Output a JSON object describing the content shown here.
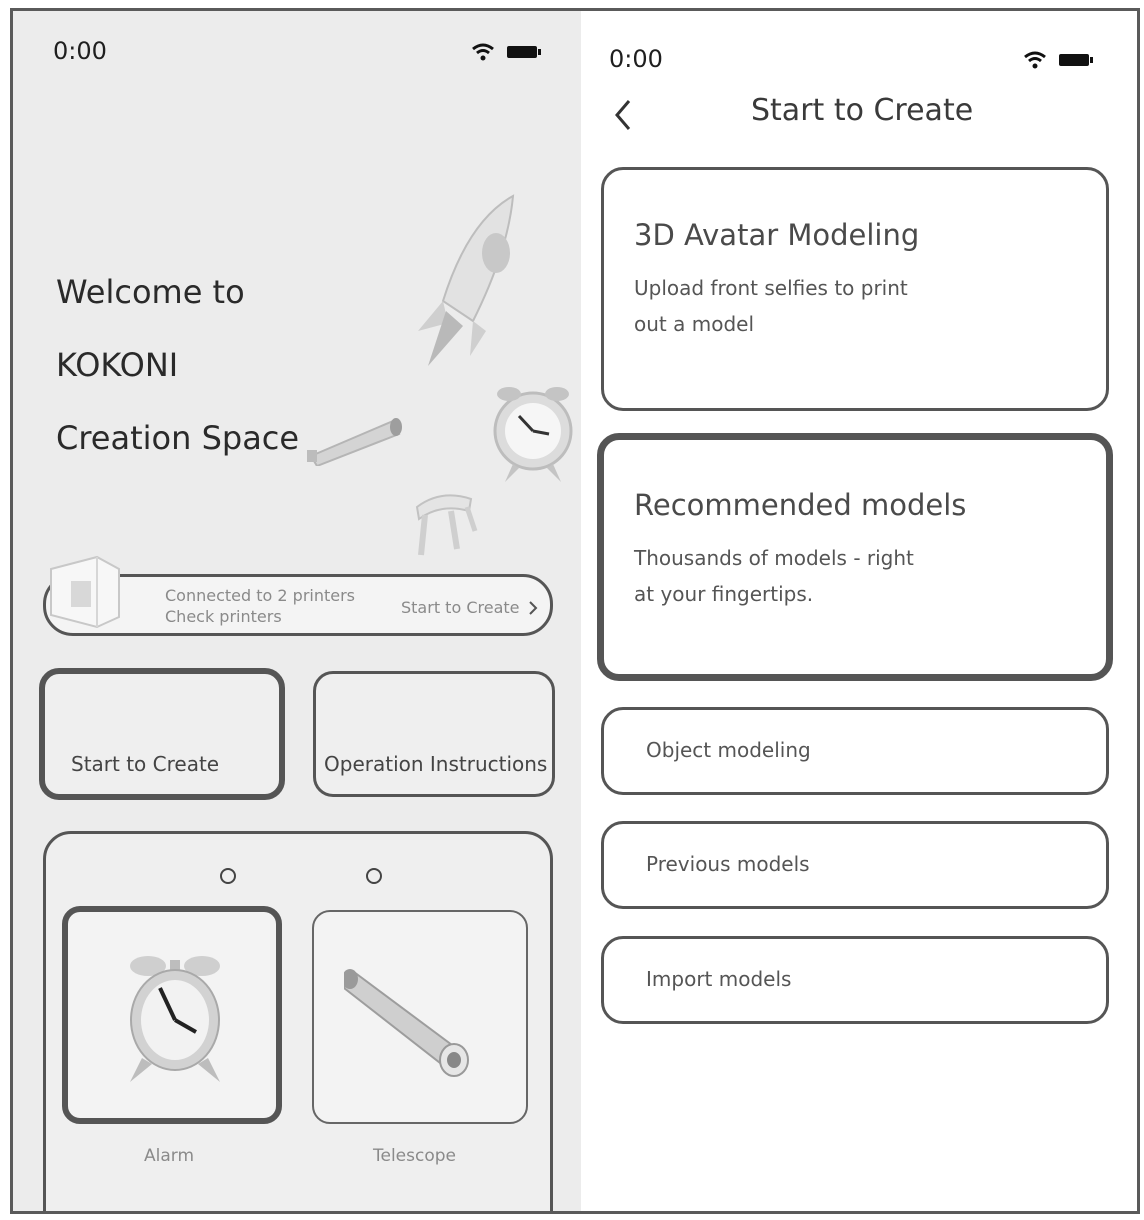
{
  "left_screen": {
    "status_time": "0:00",
    "welcome_lines": [
      "Welcome to",
      "KOKONI",
      "Creation Space"
    ],
    "printer_bar": {
      "status": "Connected to 2 printers",
      "check": "Check printers",
      "link": "Start to Create"
    },
    "tiles": {
      "start": "Start to Create",
      "instructions": "Operation Instructions"
    },
    "models": [
      {
        "label": "Alarm",
        "icon": "alarm-clock-icon"
      },
      {
        "label": "Telescope",
        "icon": "telescope-icon"
      }
    ],
    "decor_icons": [
      "rocket-icon",
      "telescope-icon",
      "alarm-clock-icon",
      "stool-icon",
      "printer-icon"
    ]
  },
  "right_screen": {
    "status_time": "0:00",
    "title": "Start to Create",
    "cards": [
      {
        "title": "3D Avatar Modeling",
        "desc_lines": [
          "Upload front selfies to print",
          "out a model"
        ]
      },
      {
        "title": "Recommended models",
        "desc_lines": [
          "Thousands of models - right",
          "at your fingertips."
        ]
      }
    ],
    "buttons": [
      "Object modeling",
      "Previous models",
      "Import models"
    ]
  },
  "colors": {
    "left_bg": "#ececec",
    "border_dark": "#555555",
    "text_muted": "#8a8a8a"
  }
}
